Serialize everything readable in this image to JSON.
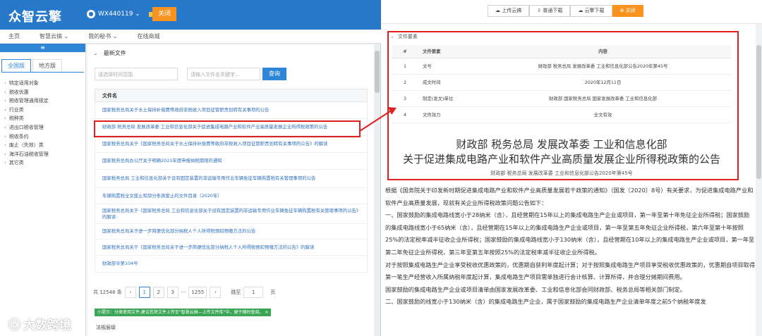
{
  "app": {
    "logo": "众智云擎",
    "account": "WX440119 ⌄",
    "close_label": "关闭"
  },
  "nav": [
    "主页",
    "智慧云搞 ⌄",
    "我的秘书 ⌄",
    "在线商城"
  ],
  "sidebar": {
    "tabs": [
      "全国版",
      "地方版"
    ],
    "items": [
      "特定适用对象",
      "税收优惠",
      "税收管理通用规定",
      "行业类",
      "税种类",
      "进出口税收管理",
      "税收条约",
      "废止（失效）类",
      "海洋石油税收管理",
      "其它类"
    ]
  },
  "main": {
    "section": "最新文件",
    "date_placeholder": "请选择时间范围",
    "keyword_placeholder": "请输入文件名关键字...",
    "query_label": "查询",
    "table_header": "文件名",
    "rows": [
      "国家税务总局关于水土保持补偿费等政府非税收入项目征管职责划转有关事项的公告",
      "财政部 税务总局 发展改革委 工业和信息化部关于促进集成电路产业和软件产业高质量发展企业所得税政策的公告",
      "国家税务总局关于《国家税务总局关于水土保持补偿费等政府非税收入项目征管职责划转有关事项的公告》的解读",
      "国家税务总局办公厅关于明确2021年度申报纳税期限的通知",
      "国家税务总局 工业和信息化部关于设有固定装置的非运输专用作业车辆免征车辆购置税有关管理事项的公告",
      "车辆购置税全文废止和部分条款废止的文件目录（2020年）",
      "国家税务总局关于《国家税务总局 工业和信息化部关于设有固定装置的非运输专用作业车辆免征车辆购置税有关管理事项的公告》的解读",
      "国家税务总局关于进一步简便优化部分纳税人个人所得税预扣预缴方法的公告",
      "国家税务总局关于《国家税务总局关于进一步简便优化部分纳税人个人所得税预扣预缴方法的公告》的解读",
      "财政部令第104号"
    ],
    "pager": {
      "total": "共 12548 条",
      "prev": "‹",
      "pages": [
        "1",
        "2",
        "3",
        "···",
        "1255"
      ],
      "next": "›",
      "jump_label": "跳至",
      "jump_value": "1",
      "page_unit": "页"
    },
    "tip": "小提示：分类使用文件,建议您将文件上传至\"智慧云搞—上传文件库\"中，便于随时查阅。 ×",
    "footer": "法规层级"
  },
  "right": {
    "buttons": [
      "上传云搞",
      "普通下载",
      "云擎下载",
      "关闭"
    ],
    "section": "文件要素",
    "columns": [
      "#",
      "文件要素",
      "内容"
    ],
    "rows": [
      [
        "1",
        "文号",
        "财政部 税务总局 发展改革委 工业和信息化部公告2020年第45号"
      ],
      [
        "2",
        "成文时间",
        "2020年12月11日"
      ],
      [
        "3",
        "制定(发文)单位",
        "财政部 国家税务总局 国家发展改革委 工业和信息化部"
      ],
      [
        "4",
        "文件效力",
        "全文有效"
      ]
    ],
    "doc_title_1": "财政部 税务总局 发展改革委 工业和信息化部",
    "doc_title_2": "关于促进集成电路产业和软件产业高质量发展企业所得税政策的公告",
    "doc_subtitle": "财政部 税务总局 发展改革委 工业和信息化部公告2020年第45号",
    "body": [
      "根据《国务院关于印发新时期促进集成电路产业和软件产业高质量发展若干政策的通知》（国发〔2020〕8号）有关要求，为促进集成电路产业和软件产业高质量发展，现就有关企业所得税政策问题公告如下：",
      "一、国家鼓励的集成电路线宽小于28纳米（含），且经营期在15年以上的集成电路生产企业或项目，第一年至第十年免征企业所得税；国家鼓励的集成电路线宽小于65纳米（含），且经营期在15年以上的集成电路生产企业或项目，第一年至第五年免征企业所得税，第六年至第十年按照25%的法定税率减半征收企业所得税；国家鼓励的集成电路线宽小于130纳米（含），且经营期在10年以上的集成电路生产企业或项目，第一年至第二年免征企业所得税，第三年至第五年按照25%的法定税率减半征收企业所得税。",
      "对于按照集成电路生产企业享受税收优惠政策的，优惠期自获利年度起计算；对于按照集成电路生产项目享受税收优惠政策的，优惠期自项目取得第一笔生产经营收入所属纳税年度起计算，集成电路生产项目需单独进行会计核算、计算所得，并合理分摊期间费用。",
      "国家鼓励的集成电路生产企业或项目清单由国家发展改革委、工业和信息化部会同财政部、税务总局等相关部门制定。",
      "二、国家鼓励的线宽小于130纳米（含）的集成电路生产企业，属于国家鼓励的集成电路生产企业清单年度之前5个纳税年度发"
    ]
  },
  "watermark": "大数跨境"
}
